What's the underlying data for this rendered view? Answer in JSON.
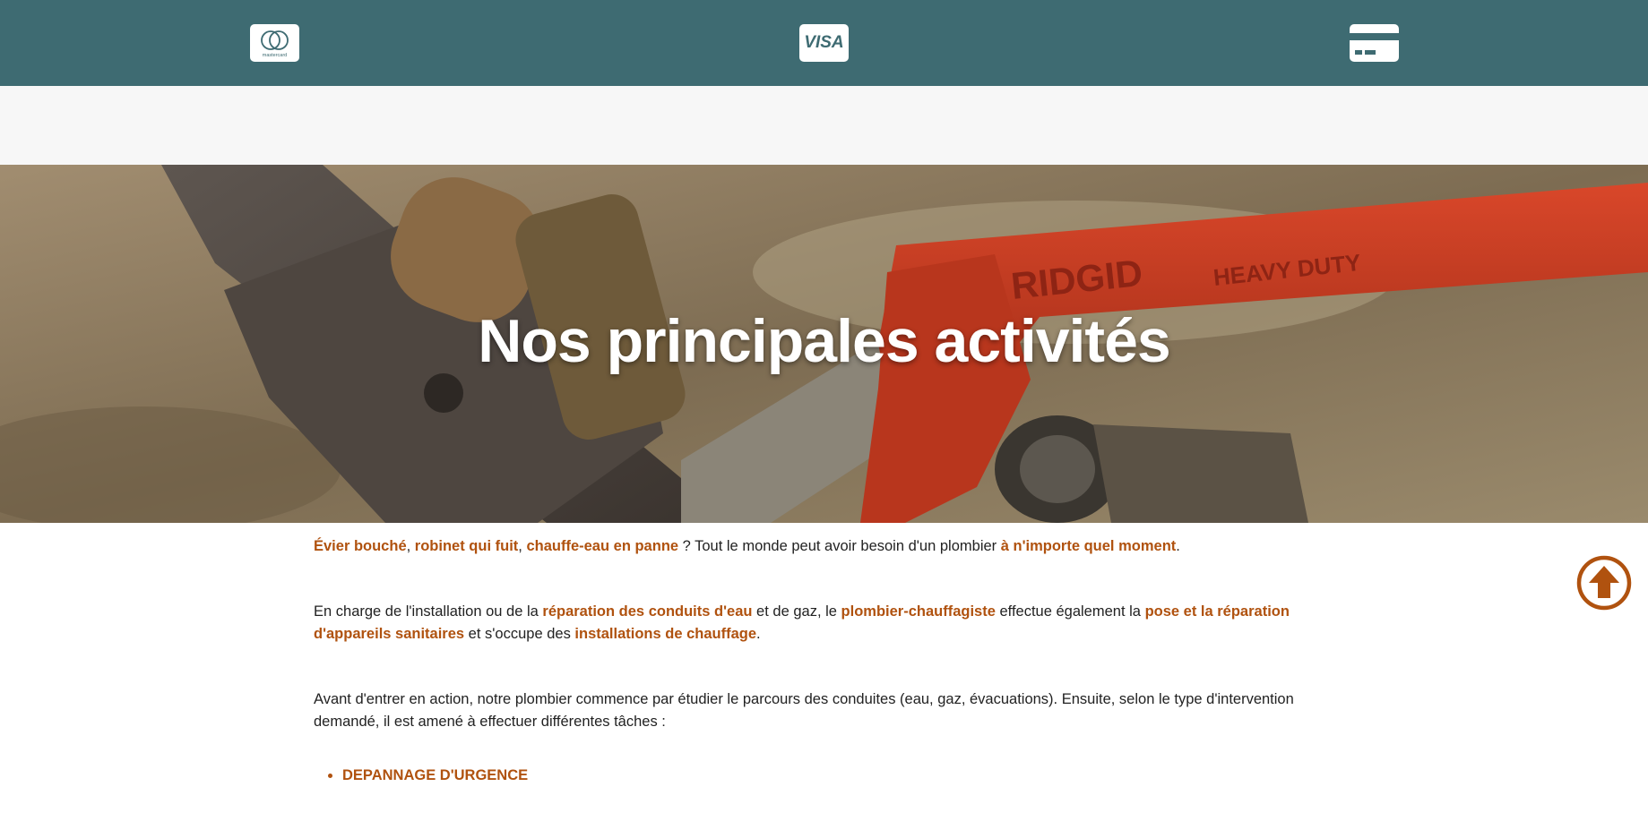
{
  "payment_methods": {
    "mastercard_label": "mastercard",
    "visa_label": "VISA",
    "card_label": "card"
  },
  "hero": {
    "title": "Nos principales activités",
    "wrench_brand": "RIDGID",
    "wrench_text": "HEAVY DUTY"
  },
  "content": {
    "p1": {
      "a1": "Évier bouché",
      "s1": ", ",
      "a2": "robinet qui fuit",
      "s2": ", ",
      "a3": "chauffe-eau en panne",
      "s3": " ? Tout le monde peut avoir besoin d'un plombier ",
      "a4": "à n'importe quel moment",
      "s4": "."
    },
    "p2": {
      "s1": "En charge de l'installation ou de la ",
      "a1": "réparation des conduits d'eau",
      "s2": " et de gaz, le ",
      "a2": "plombier-chauffagiste",
      "s3": " effectue également la ",
      "a3": "pose et la réparation d'appareils sanitaires",
      "s4": " et s'occupe des ",
      "a4": "installations de chauffage",
      "s5": "."
    },
    "p3": "Avant d'entrer en action, notre plombier commence par étudier le parcours des conduites (eau, gaz, évacuations). Ensuite, selon le type d'intervention demandé, il est amené à effectuer différentes tâches :",
    "list": [
      "DEPANNAGE D'URGENCE"
    ]
  },
  "colors": {
    "topbar": "#3e6b72",
    "accent": "#b0520f",
    "band": "#f7f7f7"
  },
  "icons": {
    "mastercard": "mastercard-icon",
    "visa": "visa-icon",
    "card": "credit-card-icon",
    "scroll_top": "arrow-up-circle-icon"
  }
}
